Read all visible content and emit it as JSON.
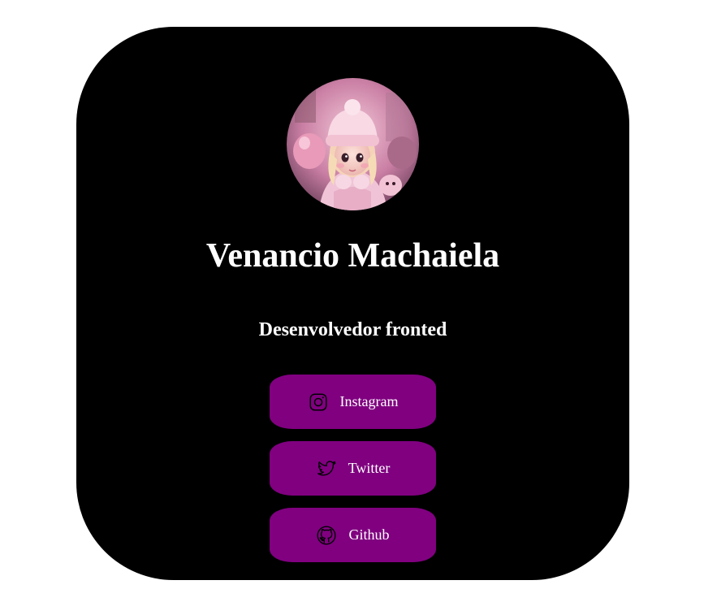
{
  "profile": {
    "name": "Venancio Machaiela",
    "role": "Desenvolvedor fronted",
    "avatar_icon": "avatar-illustration"
  },
  "links": [
    {
      "label": "Instagram",
      "icon": "instagram-icon"
    },
    {
      "label": "Twitter",
      "icon": "twitter-icon"
    },
    {
      "label": "Github",
      "icon": "github-icon"
    }
  ],
  "colors": {
    "page_background": "#ffffff",
    "card_background": "#000000",
    "button_background": "#800080",
    "text": "#ffffff"
  }
}
